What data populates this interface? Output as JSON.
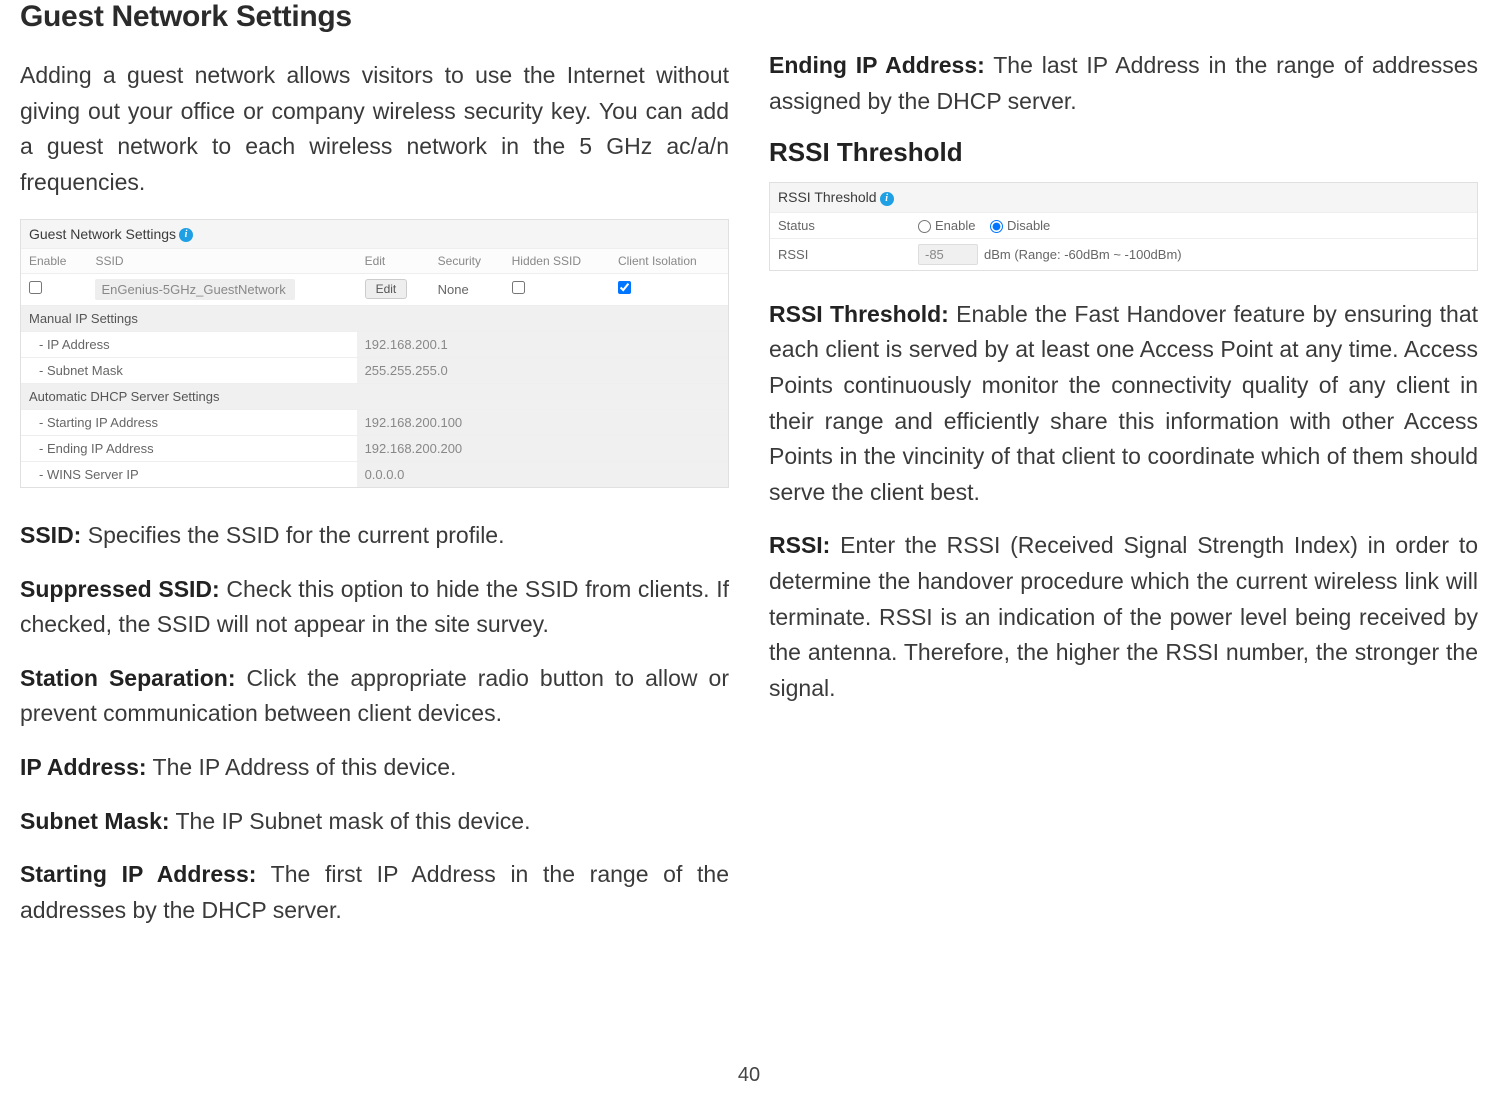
{
  "page": {
    "title": "Guest Network Settings",
    "intro": "Adding a guest network allows visitors to use the Internet without giving out your office or company wireless security key. You can add a guest network to each wireless network in the 5 GHz ac/a/n frequencies.",
    "number": "40"
  },
  "guest_shot": {
    "caption": "Guest Network Settings",
    "columns": [
      "Enable",
      "SSID",
      "Edit",
      "Security",
      "Hidden SSID",
      "Client Isolation"
    ],
    "row": {
      "ssid": "EnGenius-5GHz_GuestNetwork",
      "edit": "Edit",
      "security": "None"
    },
    "manual_label": "Manual IP Settings",
    "manual": [
      {
        "label": "- IP Address",
        "value": "192.168.200.1"
      },
      {
        "label": "- Subnet Mask",
        "value": "255.255.255.0"
      }
    ],
    "dhcp_label": "Automatic DHCP Server Settings",
    "dhcp": [
      {
        "label": "- Starting IP Address",
        "value": "192.168.200.100"
      },
      {
        "label": "- Ending IP Address",
        "value": "192.168.200.200"
      },
      {
        "label": "- WINS Server IP",
        "value": "0.0.0.0"
      }
    ]
  },
  "defs_left": {
    "ssid_term": "SSID:",
    "ssid_text": " Specifies the SSID for the current profile.",
    "sup_term": "Suppressed SSID:",
    "sup_text": " Check this option to hide the SSID from clients. If checked, the SSID will not appear in the site survey.",
    "sep_term": "Station Separation:",
    "sep_text": " Click the appropriate radio button to allow or prevent communication between client devices.",
    "ip_term": "IP Address:",
    "ip_text": " The IP Address of this device.",
    "mask_term": "Subnet Mask:",
    "mask_text": " The IP Subnet mask of this device.",
    "start_term": "Starting IP Address:",
    "start_text": " The first IP Address in the range of the addresses by the DHCP server."
  },
  "defs_right": {
    "end_term": "Ending IP Address:",
    "end_text": " The last IP Address in the range of addresses assigned by the DHCP server.",
    "rssi_heading": "RSSI Threshold",
    "rssi_thresh_term": "RSSI Threshold:",
    "rssi_thresh_text": " Enable the Fast Handover feature by ensuring that each client is served by at least one Access Point at any time. Access Points continuously monitor the connectivity quality of any client in their range and efficiently share this information with other Access Points in the vincinity of that client to coordinate which of them should serve the client best.",
    "rssi_term": "RSSI:",
    "rssi_text": " Enter the RSSI (Received Signal Strength Index) in order to determine the handover procedure which the current wireless link will terminate. RSSI is an indication of the power level being received by the antenna. Therefore, the higher the RSSI number, the stronger the signal."
  },
  "rssi_shot": {
    "caption": "RSSI Threshold",
    "status_label": "Status",
    "enable_label": "Enable",
    "disable_label": "Disable",
    "rssi_label": "RSSI",
    "rssi_value": "-85",
    "rssi_unit": "dBm (Range: -60dBm ~ -100dBm)"
  }
}
